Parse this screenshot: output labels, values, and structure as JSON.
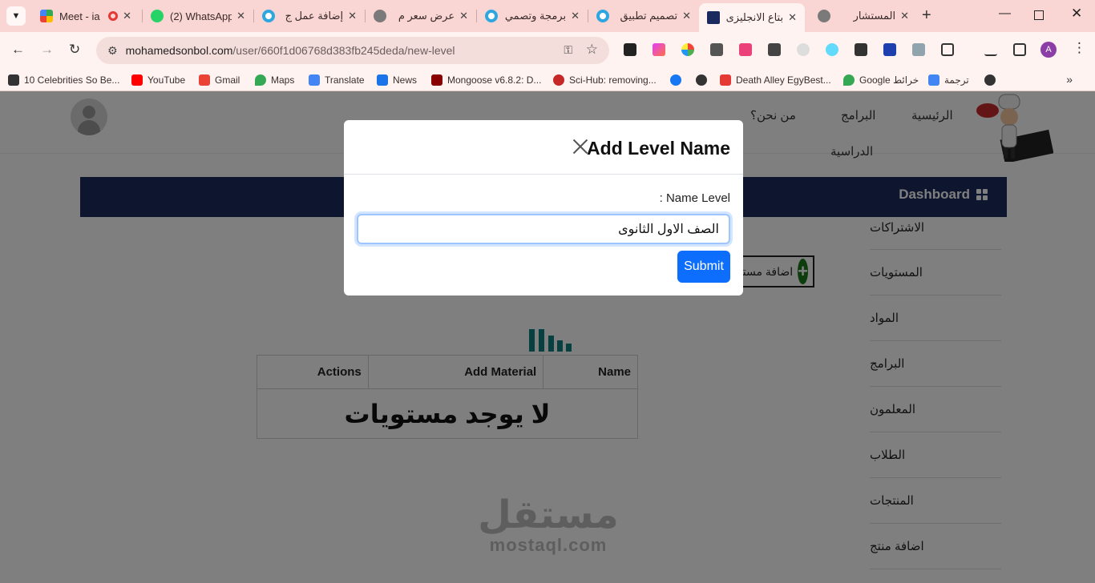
{
  "browser": {
    "tabs": [
      {
        "label": "Meet - ia",
        "icon": "google-meet-icon",
        "active": false
      },
      {
        "label": "(2) WhatsApp",
        "icon": "whatsapp-icon",
        "active": false
      },
      {
        "label": "إضافة عمل ج",
        "icon": "mostaql-icon",
        "active": false
      },
      {
        "label": "عرض سعر م",
        "icon": "globe-icon",
        "active": false
      },
      {
        "label": "برمجة وتصمي",
        "icon": "mostaql-icon",
        "active": false
      },
      {
        "label": "تصميم تطبيق",
        "icon": "mostaql-icon",
        "active": false
      },
      {
        "label": "بتاع الانجليزى",
        "icon": "site-logo-icon",
        "active": true
      },
      {
        "label": "المستشار",
        "icon": "globe-icon",
        "active": false
      }
    ],
    "new_tab_glyph": "+",
    "url": {
      "host": "mohamedsonbol.com",
      "path": "/user/660f1d06768d383fb245deda/new-level"
    },
    "profile_initial": "A",
    "bookmarks": [
      {
        "label": "10 Celebrities So Be...",
        "icon": "hb-icon"
      },
      {
        "label": "YouTube",
        "icon": "youtube-icon"
      },
      {
        "label": "Gmail",
        "icon": "gmail-icon"
      },
      {
        "label": "Maps",
        "icon": "maps-icon"
      },
      {
        "label": "Translate",
        "icon": "translate-icon"
      },
      {
        "label": "News",
        "icon": "news-icon"
      },
      {
        "label": "Mongoose v6.8.2: D...",
        "icon": "mongoose-icon"
      },
      {
        "label": "Sci-Hub: removing...",
        "icon": "scihub-icon"
      },
      {
        "label": "",
        "icon": "facebook-icon"
      },
      {
        "label": "",
        "icon": "globe-icon"
      },
      {
        "label": "Death Alley EgyBest...",
        "icon": "egybest-icon"
      },
      {
        "label": "Google خرائط",
        "icon": "maps-icon"
      },
      {
        "label": "ترجمة",
        "icon": "translate-icon"
      },
      {
        "label": "",
        "icon": "globe-icon"
      }
    ]
  },
  "site": {
    "nav": {
      "home": "الرئيسية",
      "programs": "البرامج",
      "about": "من نحن؟",
      "study": "الدراسية"
    },
    "dashboard_title": "Dashboard",
    "sidebar": [
      "الاشتراكات",
      "المستويات",
      "المواد",
      "البرامج",
      "المعلمون",
      "الطلاب",
      "المنتجات",
      "اضافة منتج"
    ],
    "add_button_label": "اضافة مستوى",
    "table": {
      "headers": {
        "name": "Name",
        "add_material": "Add Material",
        "actions": "Actions"
      },
      "empty_message": "لا يوجد مستويات"
    },
    "watermark": {
      "arabic": "مستقل",
      "latin": "mostaql.com"
    }
  },
  "modal": {
    "title": "Add Level Name",
    "field_label": "Name Level :",
    "input_value": "الصف الاول الثانوى",
    "submit_label": "Submit"
  },
  "colors": {
    "dashboard_bar": "#1b2a5e",
    "submit": "#0d6efd",
    "add_button_plus": "#1a7a1a",
    "loader": "#0f8080",
    "tabbar": "#f9d6d3"
  }
}
